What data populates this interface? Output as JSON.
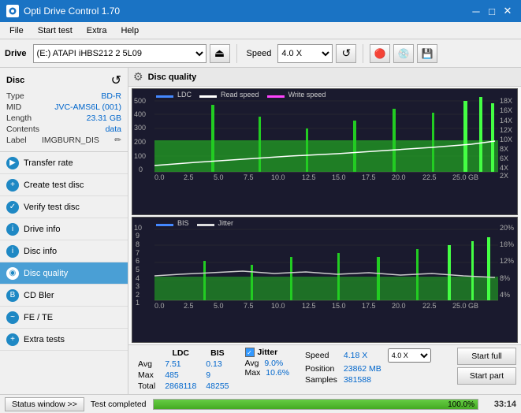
{
  "titlebar": {
    "title": "Opti Drive Control 1.70",
    "controls": [
      "minimize",
      "maximize",
      "close"
    ]
  },
  "menubar": {
    "items": [
      "File",
      "Start test",
      "Extra",
      "Help"
    ]
  },
  "toolbar": {
    "drive_label": "Drive",
    "drive_value": "(E:) ATAPI iHBS212  2 5L09",
    "speed_label": "Speed",
    "speed_value": "4.0 X"
  },
  "disc": {
    "title": "Disc",
    "type_label": "Type",
    "type_value": "BD-R",
    "mid_label": "MID",
    "mid_value": "JVC-AMS6L (001)",
    "length_label": "Length",
    "length_value": "23.31 GB",
    "contents_label": "Contents",
    "contents_value": "data",
    "label_label": "Label",
    "label_value": "IMGBURN_DIS"
  },
  "nav": {
    "items": [
      {
        "label": "Transfer rate",
        "active": false
      },
      {
        "label": "Create test disc",
        "active": false
      },
      {
        "label": "Verify test disc",
        "active": false
      },
      {
        "label": "Drive info",
        "active": false
      },
      {
        "label": "Disc info",
        "active": false
      },
      {
        "label": "Disc quality",
        "active": true
      },
      {
        "label": "CD Bler",
        "active": false
      },
      {
        "label": "FE / TE",
        "active": false
      },
      {
        "label": "Extra tests",
        "active": false
      }
    ]
  },
  "chart": {
    "title": "Disc quality",
    "legend_top": [
      {
        "label": "LDC",
        "color": "#00aaff"
      },
      {
        "label": "Read speed",
        "color": "#ffffff"
      },
      {
        "label": "Write speed",
        "color": "#ff44ff"
      }
    ],
    "legend_bottom": [
      {
        "label": "BIS",
        "color": "#00aaff"
      },
      {
        "label": "Jitter",
        "color": "#dddddd"
      }
    ],
    "top_y_left": [
      "500",
      "400",
      "300",
      "200",
      "100",
      "0"
    ],
    "top_y_right": [
      "18X",
      "16X",
      "14X",
      "12X",
      "10X",
      "8X",
      "6X",
      "4X",
      "2X"
    ],
    "bottom_y_left": [
      "10",
      "9",
      "8",
      "7",
      "6",
      "5",
      "4",
      "3",
      "2",
      "1"
    ],
    "bottom_y_right": [
      "20%",
      "16%",
      "12%",
      "8%",
      "4%"
    ],
    "x_labels": [
      "0.0",
      "2.5",
      "5.0",
      "7.5",
      "10.0",
      "12.5",
      "15.0",
      "17.5",
      "20.0",
      "22.5",
      "25.0 GB"
    ]
  },
  "stats": {
    "columns": [
      "LDC",
      "BIS"
    ],
    "rows": [
      {
        "label": "Avg",
        "ldc": "7.51",
        "bis": "0.13"
      },
      {
        "label": "Max",
        "ldc": "485",
        "bis": "9"
      },
      {
        "label": "Total",
        "ldc": "2868118",
        "bis": "48255"
      }
    ],
    "jitter": {
      "label": "Jitter",
      "avg": "9.0%",
      "max": "10.6%"
    },
    "speed": {
      "speed_label": "Speed",
      "speed_value": "4.18 X",
      "speed_target": "4.0 X",
      "position_label": "Position",
      "position_value": "23862 MB",
      "samples_label": "Samples",
      "samples_value": "381588"
    },
    "buttons": {
      "start_full": "Start full",
      "start_part": "Start part"
    }
  },
  "statusbar": {
    "window_btn": "Status window >>",
    "progress": 100,
    "progress_text": "100.0%",
    "status_text": "Test completed",
    "time": "33:14"
  }
}
